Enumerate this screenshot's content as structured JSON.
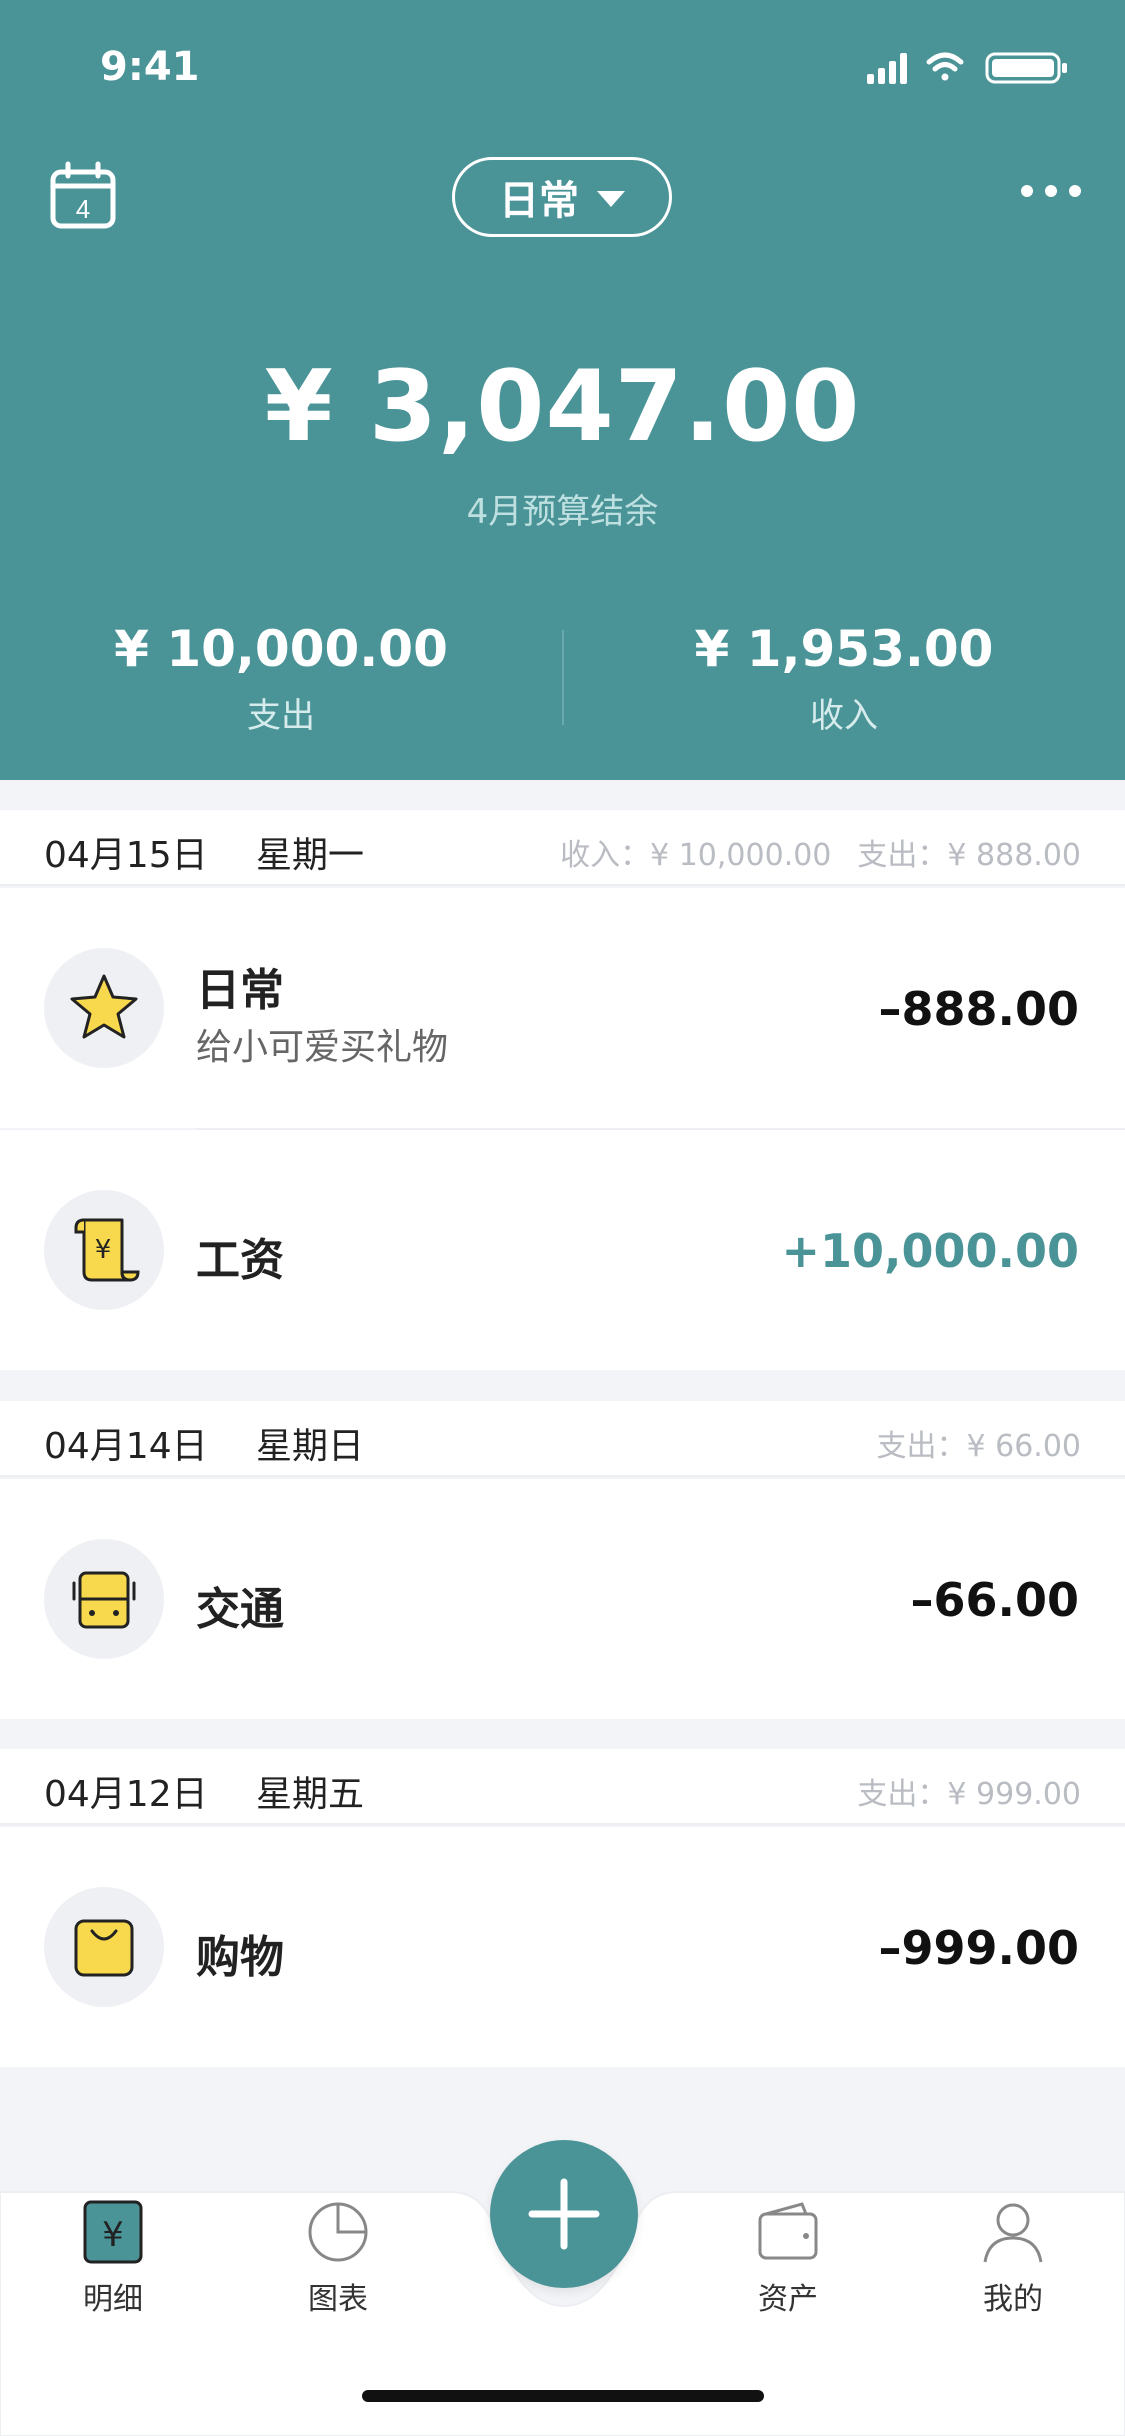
{
  "status_bar": {
    "time": "9:41"
  },
  "header": {
    "calendar_day": "4",
    "book_name": "日常",
    "balance_amount": "¥ 3,047.00",
    "balance_label": "4月预算结余",
    "expense_amount": "¥ 10,000.00",
    "expense_label": "支出",
    "income_amount": "¥ 1,953.00",
    "income_label": "收入"
  },
  "days": [
    {
      "date": "04月15日",
      "weekday": "星期一",
      "income_label": "收入：",
      "income_value": "¥ 10,000.00",
      "expense_label": "支出：",
      "expense_value": "¥ 888.00",
      "transactions": [
        {
          "category": "日常",
          "note": "给小可爱买礼物",
          "amount": "–888.00",
          "icon": "star-icon"
        },
        {
          "category": "工资",
          "note": "",
          "amount": "+10,000.00",
          "icon": "scroll-yuan-icon"
        }
      ]
    },
    {
      "date": "04月14日",
      "weekday": "星期日",
      "expense_label": "支出：",
      "expense_value": "¥ 66.00",
      "transactions": [
        {
          "category": "交通",
          "note": "",
          "amount": "–66.00",
          "icon": "bus-icon"
        }
      ]
    },
    {
      "date": "04月12日",
      "weekday": "星期五",
      "expense_label": "支出：",
      "expense_value": "¥ 999.00",
      "transactions": [
        {
          "category": "购物",
          "note": "",
          "amount": "–999.00",
          "icon": "shopping-bag-icon"
        }
      ]
    }
  ],
  "tabbar": {
    "tabs": [
      {
        "label": "明细",
        "icon": "yuan-ledger-icon"
      },
      {
        "label": "图表",
        "icon": "pie-chart-icon"
      },
      {
        "label": "资产",
        "icon": "wallet-icon"
      },
      {
        "label": "我的",
        "icon": "person-icon"
      }
    ],
    "add_icon": "plus-icon"
  },
  "colors": {
    "accent": "#4a9498",
    "icon_yellow": "#f8d84c",
    "background": "#f3f4f7"
  }
}
